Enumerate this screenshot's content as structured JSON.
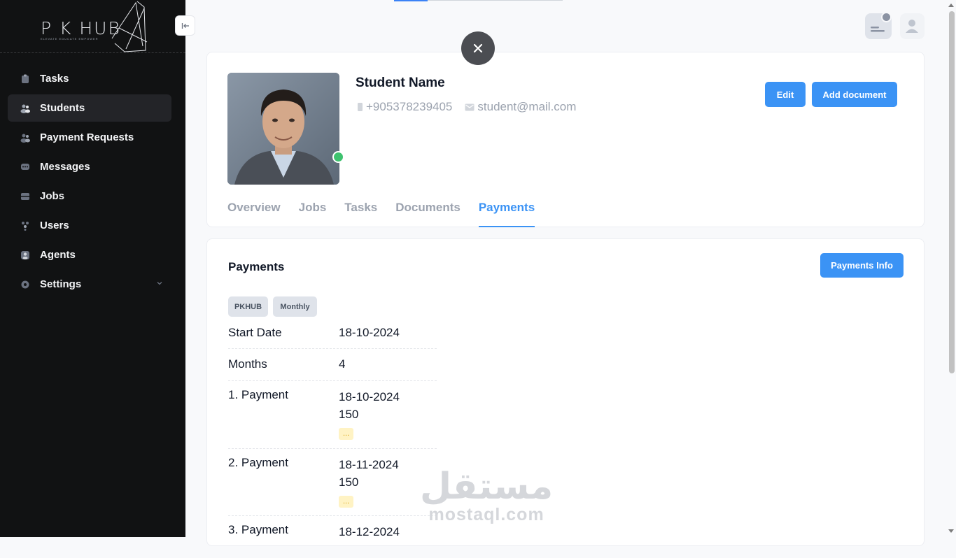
{
  "brand": {
    "logo_text": "P K HUB",
    "tagline": "ELEVATE EDUCATE EMPOWER"
  },
  "sidebar": {
    "items": [
      {
        "label": "Tasks",
        "icon": "tasks-icon"
      },
      {
        "label": "Students",
        "icon": "students-icon",
        "active": true
      },
      {
        "label": "Payment Requests",
        "icon": "payment-requests-icon"
      },
      {
        "label": "Messages",
        "icon": "messages-icon"
      },
      {
        "label": "Jobs",
        "icon": "jobs-icon"
      },
      {
        "label": "Users",
        "icon": "users-icon"
      },
      {
        "label": "Agents",
        "icon": "agents-icon"
      },
      {
        "label": "Settings",
        "icon": "gear-icon",
        "has_submenu": true
      }
    ]
  },
  "profile": {
    "name": "Student Name",
    "phone": "+905378239405",
    "email": "student@mail.com",
    "status": "online",
    "edit_label": "Edit",
    "add_document_label": "Add document",
    "tabs": [
      {
        "label": "Overview"
      },
      {
        "label": "Jobs"
      },
      {
        "label": "Tasks"
      },
      {
        "label": "Documents"
      },
      {
        "label": "Payments",
        "active": true
      }
    ]
  },
  "payments": {
    "title": "Payments",
    "info_button": "Payments Info",
    "chips": [
      "PKHUB",
      "Monthly"
    ],
    "start_date_label": "Start Date",
    "start_date": "18-10-2024",
    "months_label": "Months",
    "months": "4",
    "items": [
      {
        "label": "1. Payment",
        "date": "18-10-2024",
        "amount": "150",
        "status": "..."
      },
      {
        "label": "2. Payment",
        "date": "18-11-2024",
        "amount": "150",
        "status": "..."
      },
      {
        "label": "3. Payment",
        "date": "18-12-2024",
        "amount": "",
        "status": ""
      }
    ]
  },
  "watermark": {
    "arabic": "مستقل",
    "latin": "mostaql.com"
  },
  "colors": {
    "accent": "#3b93f5",
    "sidebar_bg": "#111213",
    "online": "#3fc26f",
    "pending_bg": "#fff3c4"
  }
}
